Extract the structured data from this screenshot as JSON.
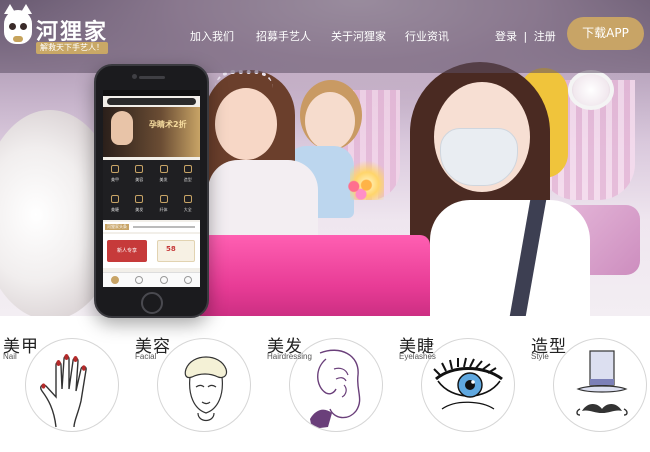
{
  "brand": {
    "name": "河狸家",
    "slogan": "解救天下手艺人！"
  },
  "nav": {
    "items": [
      {
        "label": "加入我们"
      },
      {
        "label": "招募手艺人"
      },
      {
        "label": "关于河狸家"
      },
      {
        "label": "行业资讯"
      }
    ],
    "login_label": "登录",
    "separator": "|",
    "register_label": "注册",
    "download_label": "下载APP"
  },
  "phone_screen": {
    "banner_text": "孕睛术2折",
    "grid_labels": [
      "美甲",
      "美容",
      "美发",
      "造型",
      "美睫",
      "美发",
      "纤体",
      "大全"
    ],
    "news_tag": "河狸家头条",
    "promo_left": "新人专享",
    "promo_right_num": "58"
  },
  "categories": [
    {
      "title": "美甲",
      "subtitle": "Nail",
      "icon": "hand-nail-icon"
    },
    {
      "title": "美容",
      "subtitle": "Facial",
      "icon": "face-facial-icon"
    },
    {
      "title": "美发",
      "subtitle": "Hairdressing",
      "icon": "hair-woman-icon"
    },
    {
      "title": "美睫",
      "subtitle": "Eyelashes",
      "icon": "eye-lash-icon"
    },
    {
      "title": "造型",
      "subtitle": "Style",
      "icon": "hat-mustache-icon"
    }
  ],
  "colors": {
    "accent_gold": "#c8a466",
    "header_overlay": "#5c4e64",
    "table_pink": "#e83c96"
  }
}
